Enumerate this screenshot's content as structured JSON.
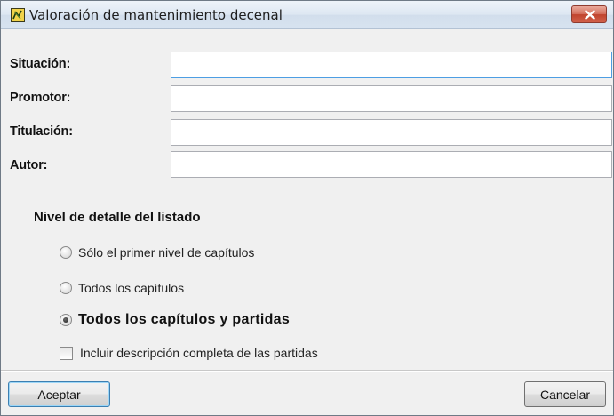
{
  "window": {
    "title": "Valoración de mantenimiento decenal",
    "icon": "app-icon",
    "close_icon": "close-icon"
  },
  "form": {
    "fields": [
      {
        "label": "Situación:",
        "value": "",
        "focused": true
      },
      {
        "label": "Promotor:",
        "value": ""
      },
      {
        "label": "Titulación:",
        "value": ""
      },
      {
        "label": "Autor:",
        "value": ""
      }
    ]
  },
  "detail_level": {
    "heading": "Nivel de detalle del listado",
    "options": [
      {
        "label": "Sólo el primer nivel de capítulos",
        "selected": false
      },
      {
        "label": "Todos los capítulos",
        "selected": false
      },
      {
        "label": "Todos los capítulos y partidas",
        "selected": true
      }
    ],
    "include_full_description": {
      "label": "Incluir descripción completa de las partidas",
      "checked": false
    }
  },
  "buttons": {
    "accept_label": "Aceptar",
    "cancel_label": "Cancelar"
  },
  "colors": {
    "close_button": "#c0432d",
    "focus_border": "#4d9ee3",
    "dialog_background": "#f0f0f0"
  }
}
